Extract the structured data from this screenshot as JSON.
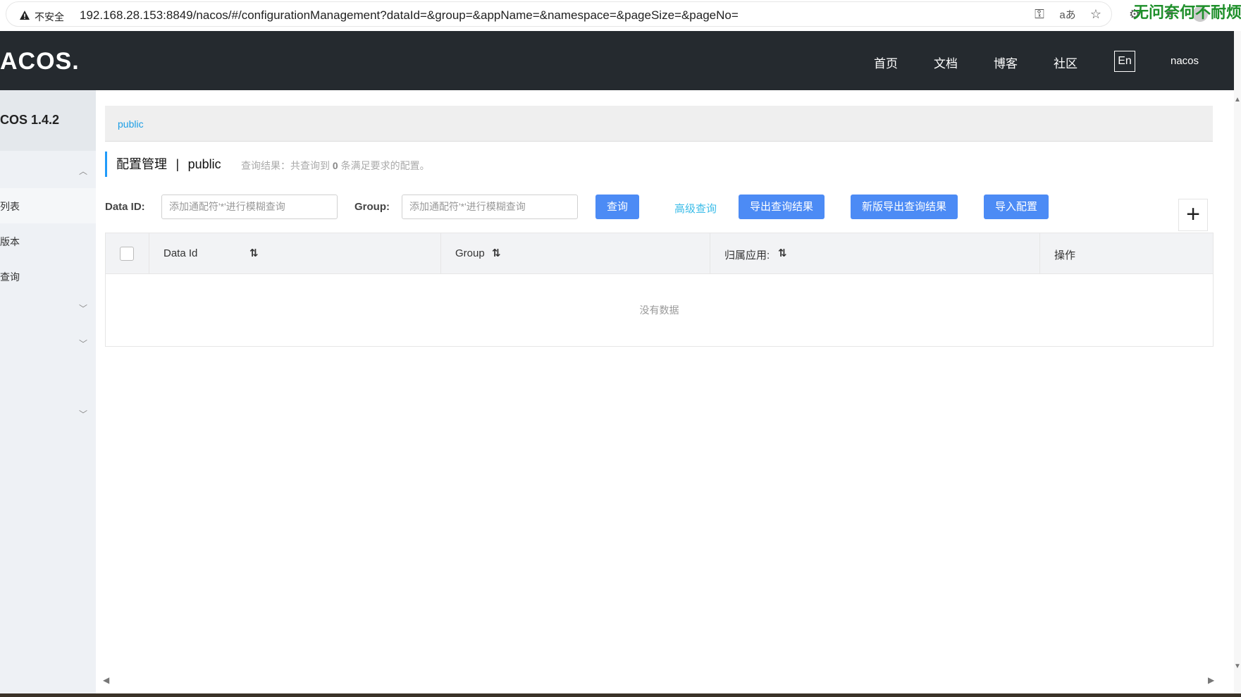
{
  "browser": {
    "security_label": "不安全",
    "url": "192.168.28.153:8849/nacos/#/configurationManagement?dataId=&group=&appName=&namespace=&pageSize=&pageNo=",
    "watermark": "无问奈何不耐烦"
  },
  "topnav": {
    "logo": "ACOS.",
    "items": [
      "首页",
      "文档",
      "博客",
      "社区"
    ],
    "lang": "En",
    "user": "nacos"
  },
  "sidebar": {
    "version": "COS 1.4.2",
    "items": [
      "列表",
      "版本",
      "查询"
    ]
  },
  "main": {
    "namespace_tab": "public",
    "title": "配置管理",
    "title_sep": "|",
    "title_ns": "public",
    "result_prefix": "查询结果：共查询到",
    "result_count": "0",
    "result_suffix": "条满足要求的配置。",
    "filters": {
      "dataid_label": "Data ID:",
      "dataid_placeholder": "添加通配符'*'进行模糊查询",
      "group_label": "Group:",
      "group_placeholder": "添加通配符'*'进行模糊查询"
    },
    "buttons": {
      "query": "查询",
      "advanced": "高级查询",
      "export": "导出查询结果",
      "export_new": "新版导出查询结果",
      "import": "导入配置",
      "add": "+"
    },
    "table": {
      "columns": [
        "Data Id",
        "Group",
        "归属应用:",
        "操作"
      ],
      "empty": "没有数据"
    }
  }
}
